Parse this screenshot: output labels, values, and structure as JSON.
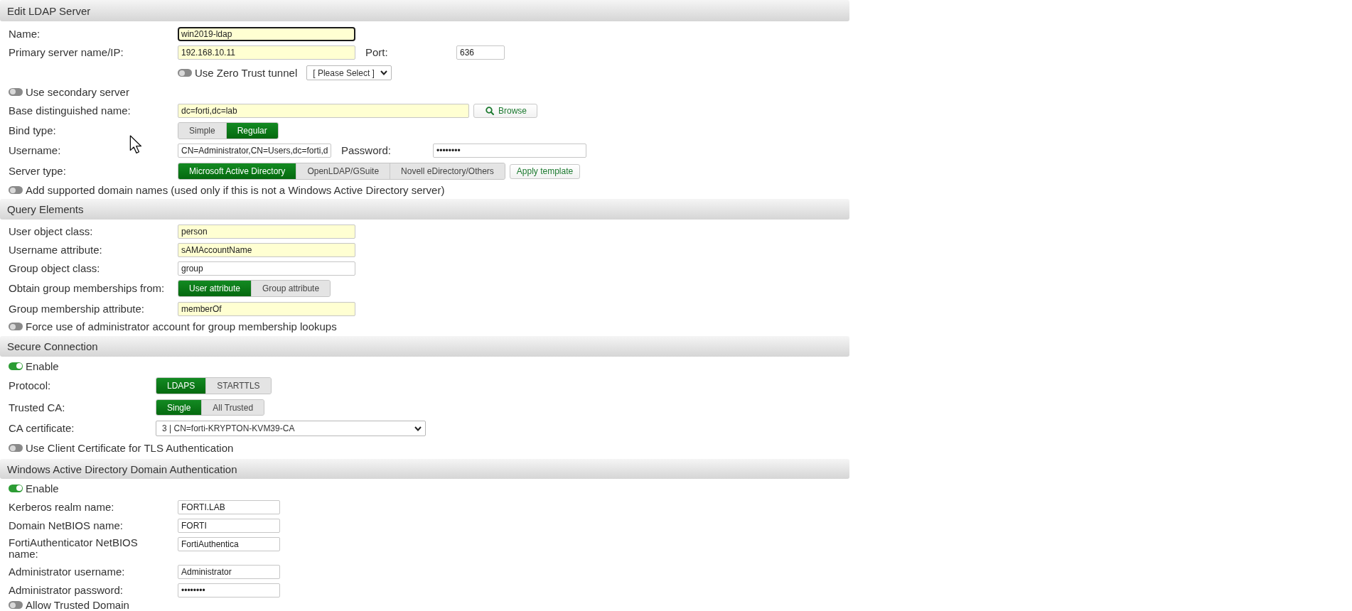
{
  "dialog": {
    "title": "Edit LDAP Server"
  },
  "server": {
    "name": {
      "label": "Name:",
      "value": "win2019-ldap",
      "required": true,
      "focused": true
    },
    "primary_server": {
      "label": "Primary server name/IP:",
      "value": "192.168.10.11",
      "required": true
    },
    "port": {
      "label": "Port:",
      "value": "636",
      "required": false
    },
    "zero_trust_tunnel": {
      "label": "Use Zero Trust tunnel",
      "on": false,
      "select": "[ Please Select ]"
    },
    "secondary_server": {
      "label": "Use secondary server",
      "on": false
    },
    "base_dn": {
      "label": "Base distinguished name:",
      "value": "dc=forti,dc=lab",
      "required": true,
      "button": "Browse"
    },
    "bind_type": {
      "label": "Bind type:",
      "options": [
        {
          "label": "Simple",
          "selected": false
        },
        {
          "label": "Regular",
          "selected": true
        }
      ]
    },
    "username": {
      "label": "Username:",
      "value": "CN=Administrator,CN=Users,dc=forti,d",
      "required": false
    },
    "password": {
      "label": "Password:",
      "value": "••••••••",
      "required": false
    },
    "server_type": {
      "label": "Server type:",
      "options": [
        {
          "label": "Microsoft Active Directory",
          "selected": true
        },
        {
          "label": "OpenLDAP/GSuite",
          "selected": false
        },
        {
          "label": "Novell eDirectory/Others",
          "selected": false
        }
      ],
      "button": "Apply template"
    },
    "supported_domains": {
      "label": "Add supported domain names (used only if this is not a Windows Active Directory server)",
      "on": false
    }
  },
  "query_elements": {
    "title": "Query Elements",
    "user_object_class": {
      "label": "User object class:",
      "value": "person",
      "required": true
    },
    "username_attribute": {
      "label": "Username attribute:",
      "value": "sAMAccountName",
      "required": true
    },
    "group_object_class": {
      "label": "Group object class:",
      "value": "group",
      "required": false
    },
    "group_membership_source": {
      "label": "Obtain group memberships from:",
      "options": [
        {
          "label": "User attribute",
          "selected": true
        },
        {
          "label": "Group attribute",
          "selected": false
        }
      ]
    },
    "group_membership_attribute": {
      "label": "Group membership attribute:",
      "value": "memberOf",
      "required": true
    },
    "force_admin_lookup": {
      "label": "Force use of administrator account for group membership lookups",
      "on": false
    }
  },
  "secure_connection": {
    "title": "Secure Connection",
    "enable": {
      "label": "Enable",
      "on": true
    },
    "protocol": {
      "label": "Protocol:",
      "options": [
        {
          "label": "LDAPS",
          "selected": true
        },
        {
          "label": "STARTTLS",
          "selected": false
        }
      ]
    },
    "trusted_ca": {
      "label": "Trusted CA:",
      "options": [
        {
          "label": "Single",
          "selected": true
        },
        {
          "label": "All Trusted",
          "selected": false
        }
      ]
    },
    "ca_certificate": {
      "label": "CA certificate:",
      "value": "3 | CN=forti-KRYPTON-KVM39-CA"
    },
    "client_certificate": {
      "label": "Use Client Certificate for TLS Authentication",
      "on": false
    }
  },
  "windows_ad": {
    "title": "Windows Active Directory Domain Authentication",
    "enable": {
      "label": "Enable",
      "on": true
    },
    "kerberos_realm": {
      "label": "Kerberos realm name:",
      "value": "FORTI.LAB",
      "required": false
    },
    "domain_netbios": {
      "label": "Domain NetBIOS name:",
      "value": "FORTI",
      "required": false
    },
    "fac_netbios": {
      "label": "FortiAuthenticator NetBIOS name:",
      "value": "FortiAuthentica",
      "required": false
    },
    "admin_username": {
      "label": "Administrator username:",
      "value": "Administrator",
      "required": false
    },
    "admin_password": {
      "label": "Administrator password:",
      "value": "••••••••",
      "required": false
    },
    "allow_trusted_domain": {
      "label": "Allow Trusted Domain",
      "on": false
    }
  }
}
